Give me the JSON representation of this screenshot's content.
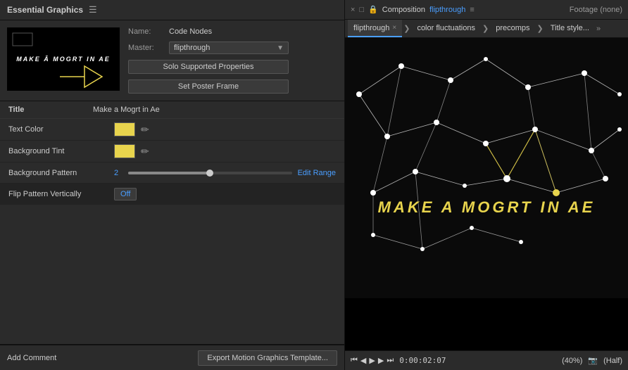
{
  "leftPanel": {
    "title": "Essential Graphics",
    "thumbnail": {
      "mainText": "MAKE Â MOGRT IN AE",
      "arrow": "▶"
    },
    "nameLabel": "Name:",
    "nameValue": "Code Nodes",
    "masterLabel": "Master:",
    "masterValue": "flipthrough",
    "soloBtnLabel": "Solo Supported Properties",
    "posterBtnLabel": "Set Poster Frame",
    "properties": {
      "sectionTitle": "Title",
      "sectionValue": "Make a Mogrt in Ae",
      "rows": [
        {
          "name": "Text Color",
          "type": "color",
          "colorValue": "#e8d44d"
        },
        {
          "name": "Background Tint",
          "type": "color",
          "colorValue": "#e8d44d"
        },
        {
          "name": "Background Pattern",
          "type": "slider",
          "numericValue": "2",
          "sliderPercent": 50,
          "editRangeLabel": "Edit Range"
        },
        {
          "name": "Flip Pattern Vertically",
          "type": "toggle",
          "toggleValue": "Off"
        }
      ]
    },
    "addCommentLabel": "Add Comment",
    "exportBtnLabel": "Export Motion Graphics Template..."
  },
  "rightPanel": {
    "windowControls": [
      "×",
      "□",
      "−"
    ],
    "lockIcon": "🔒",
    "compositionLabel": "Composition",
    "compositionName": "flipthrough",
    "menuIcon": "≡",
    "footageLabel": "Footage (none)",
    "tabs": [
      {
        "label": "flipthrough",
        "active": true,
        "closable": true
      },
      {
        "label": "color fluctuations",
        "active": false,
        "closable": false
      },
      {
        "label": "precomps",
        "active": false,
        "closable": false
      },
      {
        "label": "Title style...",
        "active": false,
        "closable": false
      }
    ],
    "previewTitle": "MAKE A MOGRT IN AE",
    "playback": {
      "zoomLabel": "(40%)",
      "timecode": "0:00:02:07",
      "qualityLabel": "(Half)"
    }
  }
}
